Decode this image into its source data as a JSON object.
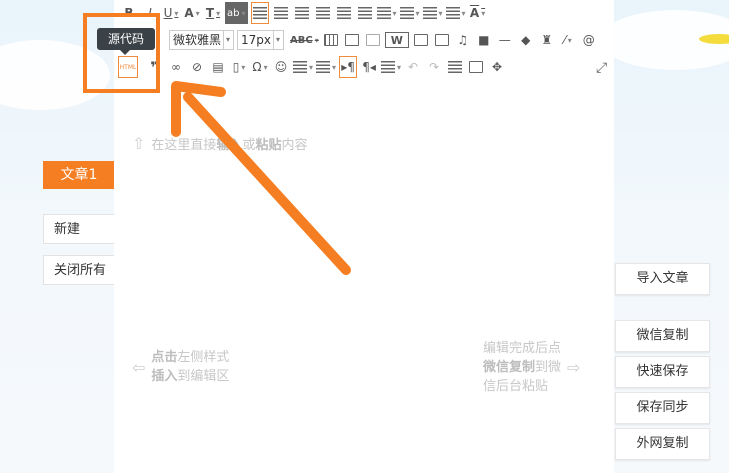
{
  "left_panel": {
    "active_tab": "文章1",
    "new_label": "新建",
    "close_all_label": "关闭所有"
  },
  "toolbar": {
    "font_family": "微软雅黑",
    "font_size": "17px",
    "html_label": "HTML",
    "tooltip": "源代码",
    "row1_icons": [
      "bold-icon",
      "italic-icon",
      "underline-icon",
      "font-color-icon",
      "text-bg-icon",
      "highlight-color-icon",
      "align-left-icon",
      "align-center-icon",
      "align-right-icon",
      "align-justify-icon",
      "indent-icon",
      "line-height-icon",
      "paragraph-spacing-icon",
      "letter-spacing-icon",
      "text-case-icon"
    ],
    "row2_icons": [
      "strikethrough-icon",
      "table-icon",
      "image-icon",
      "multi-image-icon",
      "word-icon",
      "picture-icon",
      "gallery-icon",
      "music-icon",
      "video-icon",
      "horizontal-rule-icon",
      "eraser-icon",
      "format-brush-icon",
      "magic-wand-icon",
      "anchor-icon"
    ],
    "row3_icons": [
      "quote-icon",
      "link-icon",
      "unlink-icon",
      "insert-block-icon",
      "page-break-icon",
      "special-char-icon",
      "emoji-icon",
      "ordered-list-icon",
      "unordered-list-icon",
      "ltr-icon",
      "rtl-icon",
      "clear-format-icon",
      "undo-icon",
      "redo-icon",
      "paragraph-icon",
      "preview-icon",
      "move-icon",
      "fullscreen-icon"
    ]
  },
  "editor": {
    "placeholder_pre": "在这里直接",
    "placeholder_insert": "输入",
    "placeholder_mid": "或",
    "placeholder_paste": "粘贴",
    "placeholder_post": "内容",
    "left_hint_line1_bold": "点击",
    "left_hint_line1": "左侧样式",
    "left_hint_line2_bold": "插入",
    "left_hint_line2": "到编辑区",
    "right_hint_line1": "编辑完成后点",
    "right_hint_line2_bold": "微信复制",
    "right_hint_line2": "到微",
    "right_hint_line3": "信后台粘贴"
  },
  "right_panel": {
    "import_label": "导入文章",
    "wechat_copy_label": "微信复制",
    "quick_save_label": "快速保存",
    "save_sync_label": "保存同步",
    "external_copy_label": "外网复制"
  },
  "colors": {
    "accent": "#f57e22",
    "tooltip_bg": "#3a4147"
  }
}
